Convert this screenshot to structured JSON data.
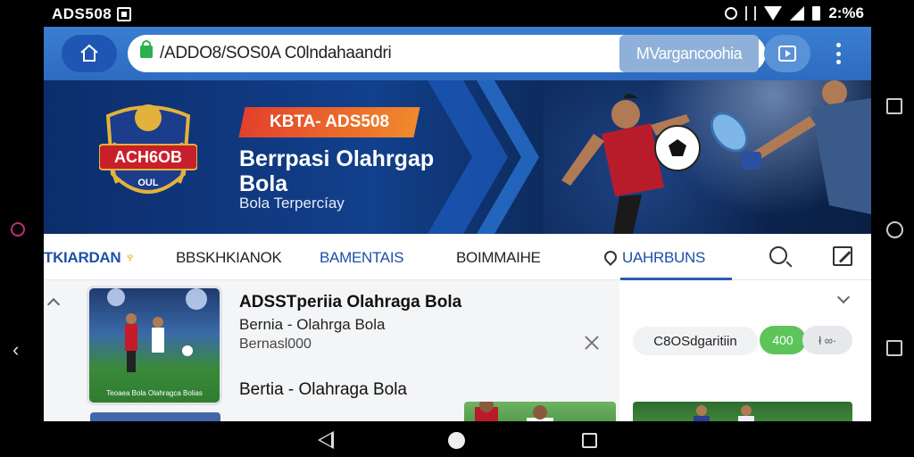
{
  "status_bar": {
    "app_label": "ADS508",
    "time": "2:%6"
  },
  "browser": {
    "url": "/ADDO8/SOS0A C0lndahaandri",
    "suggestion": "MVargancoohia"
  },
  "hero": {
    "badge_text": "ACH6OB",
    "badge_sub": "OUL",
    "promo": "KBTA- ADS508",
    "title": "Berrpasi Olahrgap Bola",
    "subtitle": "Bola Terpercíay"
  },
  "categories": [
    {
      "label": "TKIARDAN"
    },
    {
      "label": "BBSKHKIANOK"
    },
    {
      "label": "BAMENTAIS"
    },
    {
      "label": "BOIMMAIHE"
    },
    {
      "label": "UAHRBUNS"
    }
  ],
  "content": {
    "thumb_caption": "Teoaea Bola Olahragca Bolias",
    "article_title": "ADSSTperiia Olahraga Bola",
    "article_sub": "Bernia - Olahrga Bola",
    "article_meta": "Bernasl000",
    "article_title_2": "Bertia - Olahraga Bola",
    "chip": "C8OSdgaritiin",
    "pill_green": "400",
    "pill_gray": "ł ∞∙"
  },
  "colors": {
    "accent": "#2d6bc0",
    "promo": "#e3402d",
    "green": "#5dc45b"
  }
}
